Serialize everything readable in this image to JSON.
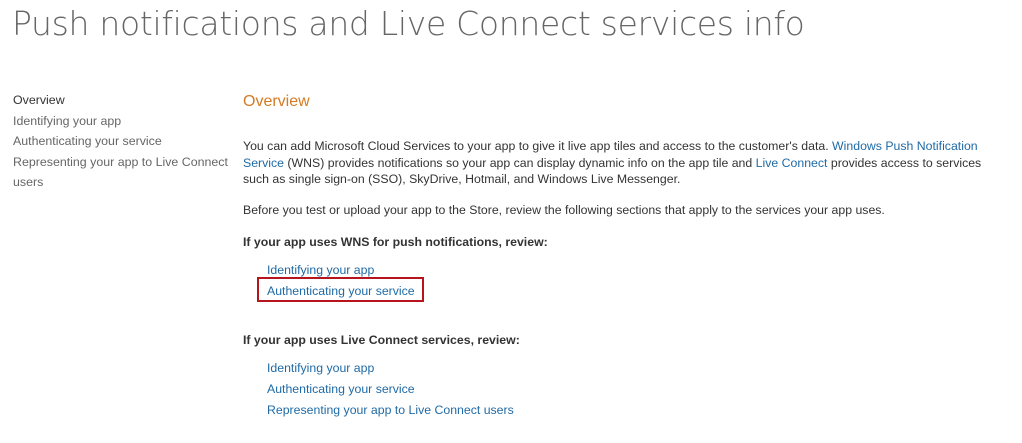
{
  "page": {
    "title": "Push notifications and Live Connect services info"
  },
  "sidebar": {
    "items": [
      {
        "label": "Overview",
        "active": true
      },
      {
        "label": "Identifying your app",
        "active": false
      },
      {
        "label": "Authenticating your service",
        "active": false
      },
      {
        "label": "Representing your app to Live Connect users",
        "active": false
      }
    ]
  },
  "main": {
    "heading": "Overview",
    "intro": {
      "part1": "You can add Microsoft Cloud Services to your app to give it live app tiles and access to the customer's data. ",
      "wns_link": "Windows Push Notification Service",
      "part2": " (WNS) provides notifications so your app can display dynamic info on the app tile and ",
      "live_link": "Live Connect",
      "part3": " provides access to services such as single sign-on (SSO), SkyDrive, Hotmail, and Windows Live Messenger."
    },
    "before_text": "Before you test or upload your app to the Store, review the following sections that apply to the services your app uses.",
    "wns_group": {
      "heading": "If your app uses WNS for push notifications, review:",
      "links": [
        "Identifying your app",
        "Authenticating your service"
      ],
      "highlighted_index": 1
    },
    "live_group": {
      "heading": "If your app uses Live Connect services, review:",
      "links": [
        "Identifying your app",
        "Authenticating your service",
        "Representing your app to Live Connect users"
      ]
    }
  },
  "colors": {
    "title": "#666666",
    "heading_accent": "#d47b24",
    "link": "#1f6aa5",
    "highlight_border": "#b8141e"
  }
}
